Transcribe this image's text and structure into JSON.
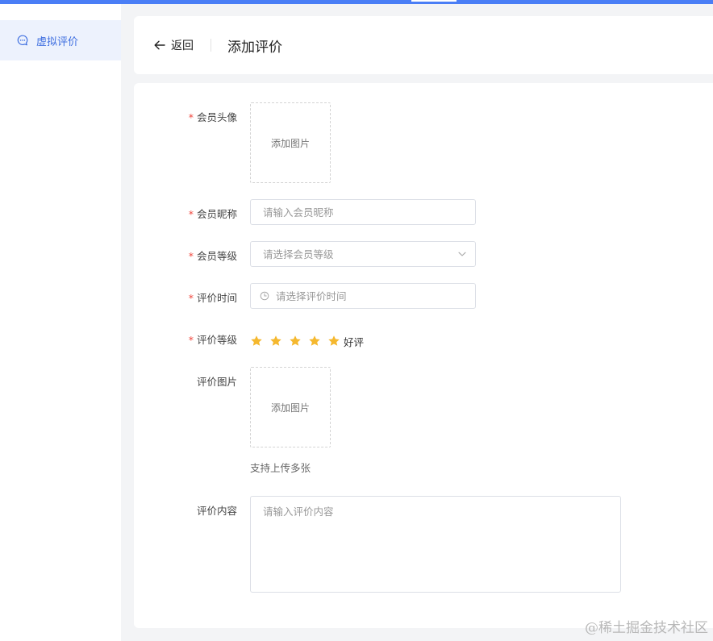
{
  "sidebar": {
    "items": [
      {
        "label": "虚拟评价",
        "icon": "chat-bubble-icon",
        "active": true
      }
    ]
  },
  "header": {
    "back_label": "返回",
    "title": "添加评价"
  },
  "form": {
    "avatar": {
      "label": "会员头像",
      "required": true,
      "upload_text": "添加图片"
    },
    "nickname": {
      "label": "会员昵称",
      "required": true,
      "placeholder": "请输入会员昵称",
      "value": ""
    },
    "level": {
      "label": "会员等级",
      "required": true,
      "placeholder": "请选择会员等级",
      "value": ""
    },
    "review_time": {
      "label": "评价时间",
      "required": true,
      "placeholder": "请选择评价时间",
      "value": ""
    },
    "rating": {
      "label": "评价等级",
      "required": true,
      "stars": 5,
      "max": 5,
      "text": "好评"
    },
    "images": {
      "label": "评价图片",
      "required": false,
      "upload_text": "添加图片",
      "hint": "支持上传多张"
    },
    "content": {
      "label": "评价内容",
      "required": false,
      "placeholder": "请输入评价内容",
      "value": ""
    }
  },
  "watermark": "@稀土掘金技术社区",
  "colors": {
    "accent": "#4a7ef6",
    "sidebar_active_bg": "#edf2fd",
    "sidebar_active_text": "#3f6fe0",
    "required": "#f0473d",
    "star": "#f5b82e"
  }
}
